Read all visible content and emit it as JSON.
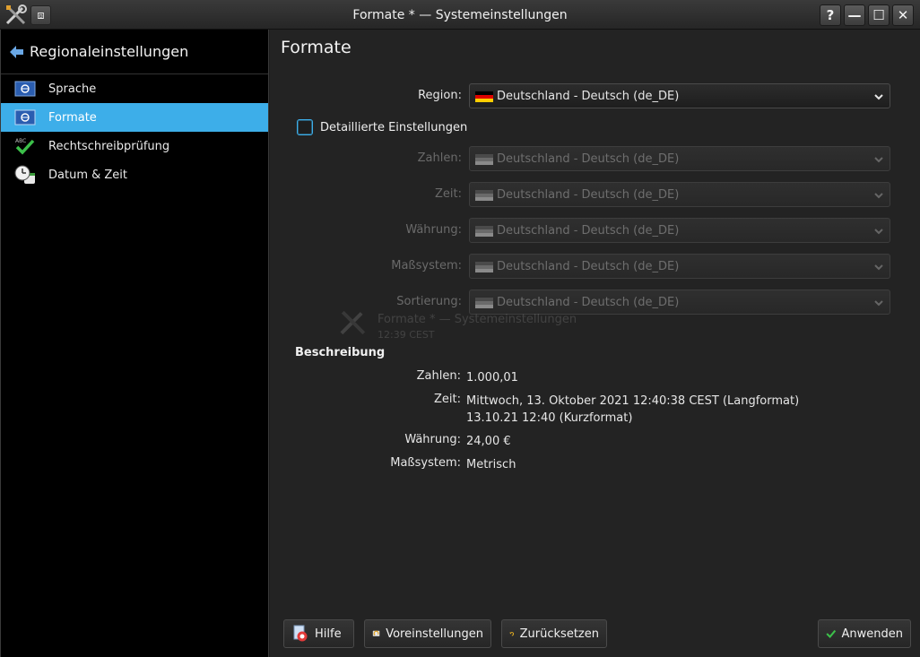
{
  "window": {
    "title": "Formate * — Systemeinstellungen",
    "pin_icon": "⧈",
    "help_btn": "?",
    "minimize_btn": "—",
    "maximize_btn": "☐",
    "close_btn": "✕"
  },
  "sidebar": {
    "back_label": "Regionaleinstellungen",
    "items": [
      {
        "label": "Sprache",
        "icon": "language-flag-icon"
      },
      {
        "label": "Formate",
        "icon": "formats-flag-icon",
        "active": true
      },
      {
        "label": "Rechtschreibprüfung",
        "icon": "spellcheck-icon"
      },
      {
        "label": "Datum & Zeit",
        "icon": "clock-icon"
      }
    ]
  },
  "main": {
    "title": "Formate",
    "region_label": "Region:",
    "region_value": "Deutschland - Deutsch (de_DE)",
    "detailed_label": "Detaillierte Einstellungen",
    "detailed_checked": false,
    "details": [
      {
        "label": "Zahlen:",
        "value": "Deutschland - Deutsch (de_DE)"
      },
      {
        "label": "Zeit:",
        "value": "Deutschland - Deutsch (de_DE)"
      },
      {
        "label": "Währung:",
        "value": "Deutschland - Deutsch (de_DE)"
      },
      {
        "label": "Maßsystem:",
        "value": "Deutschland - Deutsch (de_DE)"
      },
      {
        "label": "Sortierung:",
        "value": "Deutschland - Deutsch (de_DE)"
      }
    ],
    "ghost_title": "Formate * — Systemeinstellungen",
    "ghost_sub": "12:39 CEST",
    "description_heading": "Beschreibung",
    "description": {
      "numbers_label": "Zahlen:",
      "numbers_value": "1.000,01",
      "time_label": "Zeit:",
      "time_long": "Mittwoch, 13. Oktober 2021 12:40:38 CEST (Langformat)",
      "time_short": "13.10.21 12:40 (Kurzformat)",
      "currency_label": "Währung:",
      "currency_value": "24,00 €",
      "measure_label": "Maßsystem:",
      "measure_value": "Metrisch"
    }
  },
  "buttons": {
    "help": "Hilfe",
    "defaults": "Voreinstellungen",
    "reset": "Zurücksetzen",
    "apply": "Anwenden"
  },
  "colors": {
    "accent": "#3daee9",
    "background": "#232323"
  }
}
